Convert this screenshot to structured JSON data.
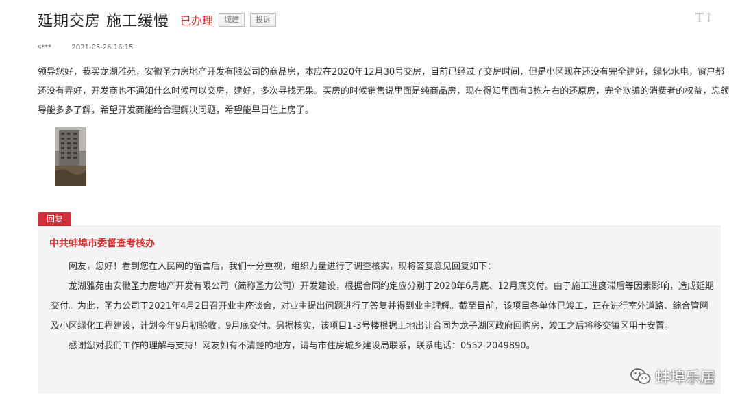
{
  "header": {
    "title": "延期交房 施工缓慢",
    "status": "已办理",
    "tags": [
      "城建",
      "投诉"
    ],
    "font_toggle_label": "T↕"
  },
  "meta": {
    "user": "s***",
    "date": "2021-05-26 16:15"
  },
  "message": {
    "text": "领导您好，我买龙湖雅苑，安徽圣力房地产开发有限公司的商品房，本应在2020年12月30号交房，目前已经过了交房时间，但是小区现在还没有完全建好，绿化水电，窗户都还没有弄好，开发商也不通知什么时候可以交房，建好，多次寻找无果。买房的时候销售说里面是纯商品房，现在得知里面有3栋左右的还原房，完全欺骗的消费者的权益，忘领导能多多了解，希望开发商能给合理解决问题，希望能早日住上房子。"
  },
  "reply": {
    "badge": "回复",
    "org": "中共蚌埠市委督查考核办",
    "paragraphs": [
      "网友，您好！看到您在人民网的留言后，我们十分重视，组织力量进行了调查核实，现将答复意见回复如下：",
      "龙湖雅苑由安徽圣力房地产开发有限公司（简称圣力公司）开发建设，根据合同约定应分别于2020年6月底、12月底交付。由于施工进度滞后等因素影响，造成延期交付。为此，圣力公司于2021年4月2日召开业主座谈会，对业主提出问题进行了答复并得到业主理解。截至目前，该项目各单体已竣工，正在进行室外道路、综合管网及小区绿化工程建设，计划今年9月初验收，9月底交付。另据核实，该项目1-3号楼根据土地出让合同为龙子湖区政府回购房，竣工之后将移交镇区用于安置。",
      "感谢您对我们工作的理解与支持！网友如有不清楚的地方，请与市住房城乡建设局联系，联系电话：0552-2049890。"
    ]
  },
  "watermark": {
    "text": "蚌埠乐居"
  },
  "colors": {
    "accent_red": "#d22b2b",
    "badge_red": "#d32f3a",
    "reply_bg": "#f4f4f6"
  }
}
